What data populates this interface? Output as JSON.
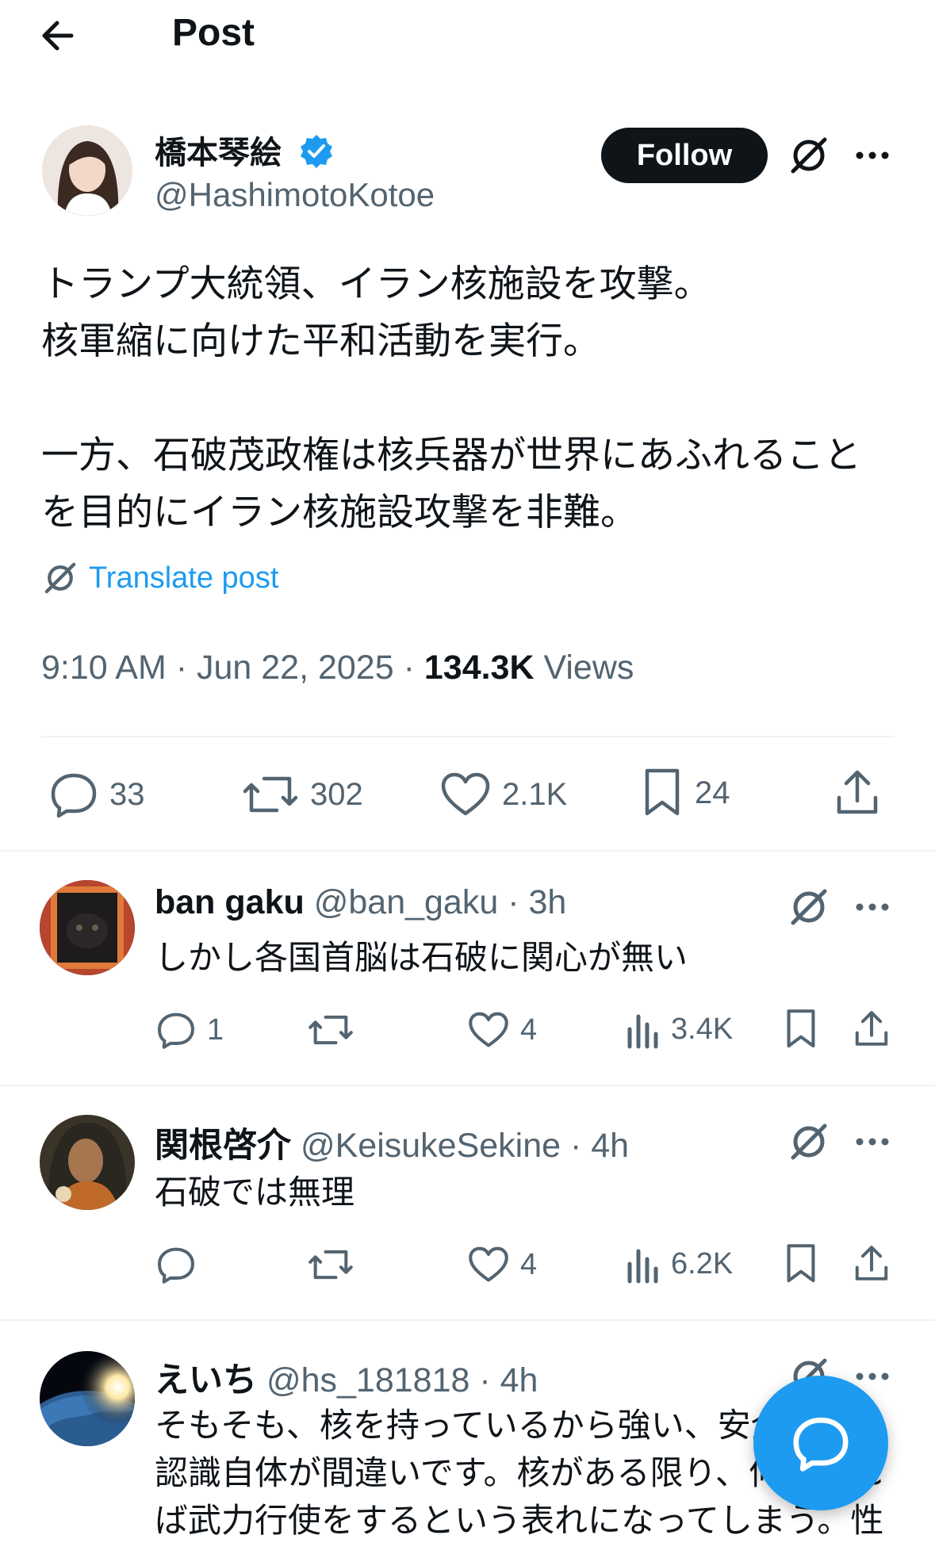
{
  "header": {
    "title": "Post"
  },
  "author": {
    "name": "橋本琴絵",
    "handle": "@HashimotoKotoe",
    "follow_label": "Follow"
  },
  "post": {
    "text": "トランプ大統領、イラン核施設を攻撃。\n核軍縮に向けた平和活動を実行。\n\n一方、石破茂政権は核兵器が世界にあふれること\nを目的にイラン核施設攻撃を非難。",
    "translate_label": "Translate post",
    "time": "9:10 AM · Jun 22, 2025 · ",
    "views_count": "134.3K",
    "views_label": " Views",
    "replies": "33",
    "reposts": "302",
    "likes": "2.1K",
    "bookmarks": "24"
  },
  "replies": [
    {
      "name": "ban gaku",
      "handle": " @ban_gaku · 3h",
      "text": "しかし各国首脳は石破に関心が無い",
      "replies": "1",
      "reposts": "",
      "likes": "4",
      "views": "3.4K"
    },
    {
      "name": "関根啓介",
      "handle": " @KeisukeSekine · 4h",
      "text": "石破では無理",
      "replies": "",
      "reposts": "",
      "likes": "4",
      "views": "6.2K"
    },
    {
      "name": "えいち",
      "handle": " @hs_181818 · 4h",
      "text": "そもそも、核を持っているから強い、安全という\n認識自体が間違いです。核がある限り、何かあれ\nば武力行使をするという表れになってしまう。性",
      "replies": "",
      "reposts": "",
      "likes": "",
      "views": ""
    }
  ],
  "colors": {
    "accent": "#1d9bf0",
    "text": "#0f1419",
    "secondary": "#536471",
    "divider": "#eff3f4"
  }
}
